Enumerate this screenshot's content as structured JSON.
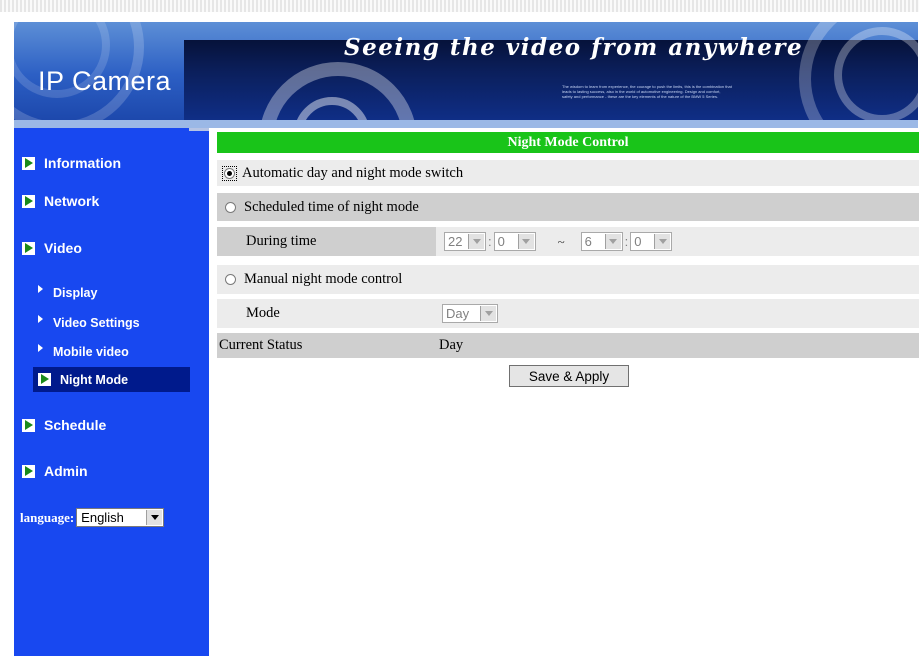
{
  "header": {
    "logo_text": "IP Camera",
    "slogan": "Seeing the video from anywhere",
    "fine_print": "The wisdom to learn from experience, the courage to push the limits, this is the combination that leads to lasting success, also in the world of automotive engineering. Design and comfort, safety and performance - these are the key elements of the nature of the BMW 5 Series."
  },
  "sidebar": {
    "items": [
      {
        "label": "Information",
        "icon": "green-arrow-icon"
      },
      {
        "label": "Network",
        "icon": "green-arrow-icon"
      },
      {
        "label": "Video",
        "icon": "green-arrow-icon"
      },
      {
        "label": "Schedule",
        "icon": "green-arrow-icon"
      },
      {
        "label": "Admin",
        "icon": "green-arrow-icon"
      }
    ],
    "video_subitems": [
      {
        "label": "Display"
      },
      {
        "label": "Video Settings"
      },
      {
        "label": "Mobile video"
      },
      {
        "label": "Night Mode",
        "active": true
      }
    ],
    "language": {
      "label": "language:",
      "value": "English"
    }
  },
  "main": {
    "title": "Night Mode Control",
    "options": {
      "auto": {
        "label": "Automatic day and night mode switch",
        "checked": true
      },
      "scheduled": {
        "label": "Scheduled time of night mode",
        "checked": false
      },
      "manual": {
        "label": "Manual night mode control",
        "checked": false
      }
    },
    "during_time": {
      "label": "During time",
      "start_hour": "22",
      "start_minute": "0",
      "separator": ":",
      "range_symbol": "~",
      "end_hour": "6",
      "end_minute": "0"
    },
    "mode": {
      "label": "Mode",
      "value": "Day"
    },
    "current_status": {
      "label": "Current Status",
      "value": "Day"
    },
    "save_button": "Save & Apply"
  },
  "colors": {
    "sidebar_bg": "#1848f0",
    "active_item_bg": "#001a8c",
    "title_bar": "#19c419",
    "row_light": "#ececec",
    "row_gray": "#cfcfcf"
  }
}
